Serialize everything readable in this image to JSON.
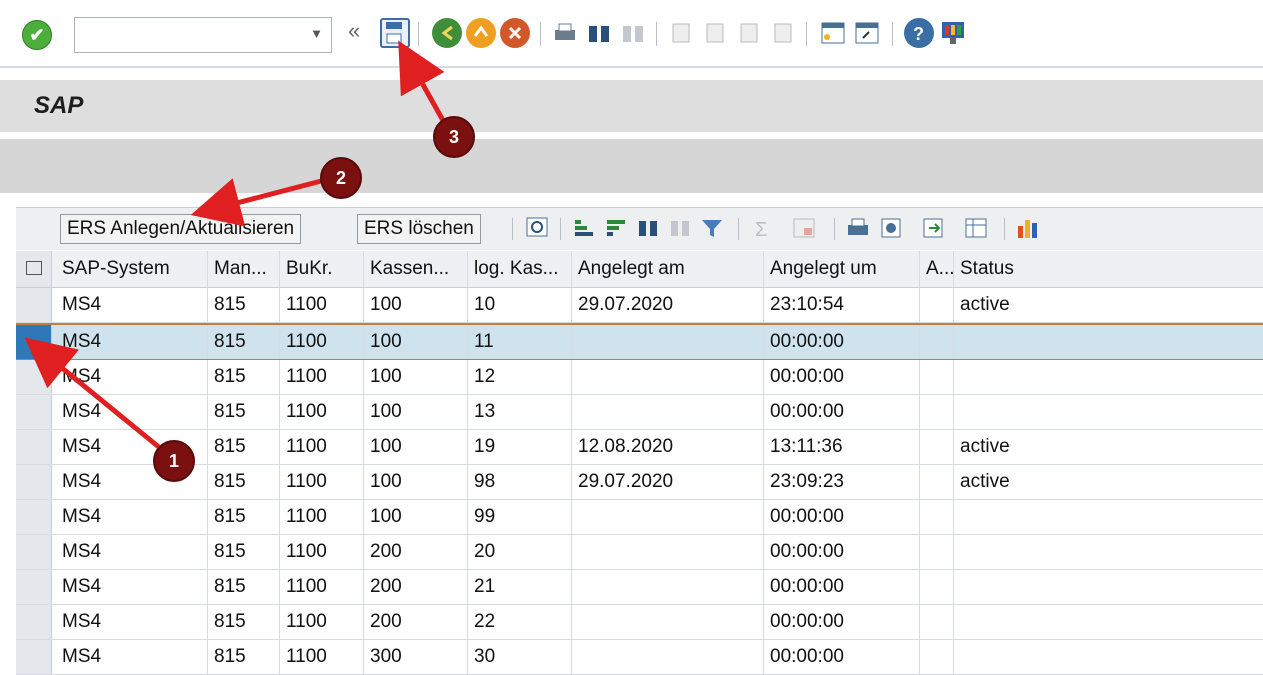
{
  "title": "SAP",
  "toolbar": {
    "command_field_value": "",
    "icons": [
      "check-icon",
      "back-double-icon",
      "save-icon",
      "back-icon",
      "exit-icon",
      "cancel-icon",
      "print-icon",
      "find-icon",
      "find-next-icon",
      "first-page-icon",
      "previous-page-icon",
      "next-page-icon",
      "last-page-icon",
      "new-session-icon",
      "shortcut-icon",
      "help-icon",
      "layout-menu-icon"
    ]
  },
  "alv_toolbar": {
    "create_update_label": "ERS Anlegen/Aktualisieren",
    "delete_label": "ERS löschen"
  },
  "table": {
    "columns": [
      "SAP-System",
      "Man...",
      "BuKr.",
      "Kassen...",
      "log. Kas...",
      "Angelegt am",
      "Angelegt um",
      "A...",
      "Status"
    ],
    "rows": [
      [
        "MS4",
        "815",
        "1100",
        "100",
        "10",
        "29.07.2020",
        "23:10:54",
        "",
        "active"
      ],
      [
        "MS4",
        "815",
        "1100",
        "100",
        "11",
        "",
        "00:00:00",
        "",
        ""
      ],
      [
        "MS4",
        "815",
        "1100",
        "100",
        "12",
        "",
        "00:00:00",
        "",
        ""
      ],
      [
        "MS4",
        "815",
        "1100",
        "100",
        "13",
        "",
        "00:00:00",
        "",
        ""
      ],
      [
        "MS4",
        "815",
        "1100",
        "100",
        "19",
        "12.08.2020",
        "13:11:36",
        "",
        "active"
      ],
      [
        "MS4",
        "815",
        "1100",
        "100",
        "98",
        "29.07.2020",
        "23:09:23",
        "",
        "active"
      ],
      [
        "MS4",
        "815",
        "1100",
        "100",
        "99",
        "",
        "00:00:00",
        "",
        ""
      ],
      [
        "MS4",
        "815",
        "1100",
        "200",
        "20",
        "",
        "00:00:00",
        "",
        ""
      ],
      [
        "MS4",
        "815",
        "1100",
        "200",
        "21",
        "",
        "00:00:00",
        "",
        ""
      ],
      [
        "MS4",
        "815",
        "1100",
        "200",
        "22",
        "",
        "00:00:00",
        "",
        ""
      ],
      [
        "MS4",
        "815",
        "1100",
        "300",
        "30",
        "",
        "00:00:00",
        "",
        ""
      ]
    ],
    "selected_row": 1
  },
  "callouts": [
    {
      "label": "1"
    },
    {
      "label": "2"
    },
    {
      "label": "3"
    }
  ],
  "colors": {
    "callout": "#7a1010",
    "arrow": "#e02020",
    "selection": "#cfe3ef"
  }
}
